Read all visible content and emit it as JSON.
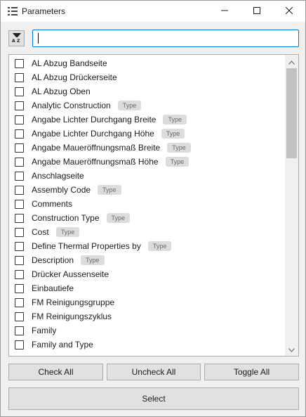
{
  "window": {
    "title": "Parameters"
  },
  "toolbar": {
    "sort_icon": "sort-alpha-filter-icon",
    "search_value": "",
    "search_placeholder": ""
  },
  "parameters": [
    {
      "name": "AL Abzug Bandseite",
      "badge": ""
    },
    {
      "name": "AL Abzug Drückerseite",
      "badge": ""
    },
    {
      "name": "AL Abzug Oben",
      "badge": ""
    },
    {
      "name": "Analytic Construction",
      "badge": "Type"
    },
    {
      "name": "Angabe Lichter Durchgang Breite",
      "badge": "Type"
    },
    {
      "name": "Angabe Lichter Durchgang Höhe",
      "badge": "Type"
    },
    {
      "name": "Angabe Maueröffnungsmaß Breite",
      "badge": "Type"
    },
    {
      "name": "Angabe Maueröffnungsmaß Höhe",
      "badge": "Type"
    },
    {
      "name": "Anschlagseite",
      "badge": ""
    },
    {
      "name": "Assembly Code",
      "badge": "Type"
    },
    {
      "name": "Comments",
      "badge": ""
    },
    {
      "name": "Construction Type",
      "badge": "Type"
    },
    {
      "name": "Cost",
      "badge": "Type"
    },
    {
      "name": "Define Thermal Properties by",
      "badge": "Type"
    },
    {
      "name": "Description",
      "badge": "Type"
    },
    {
      "name": "Drücker Aussenseite",
      "badge": ""
    },
    {
      "name": "Einbautiefe",
      "badge": ""
    },
    {
      "name": "FM Reinigungsgruppe",
      "badge": ""
    },
    {
      "name": "FM Reinigungszyklus",
      "badge": ""
    },
    {
      "name": "Family",
      "badge": ""
    },
    {
      "name": "Family and Type",
      "badge": ""
    }
  ],
  "buttons": {
    "check_all": "Check All",
    "uncheck_all": "Uncheck All",
    "toggle_all": "Toggle All",
    "select": "Select"
  },
  "colors": {
    "accent": "#0078d7",
    "badge_bg": "#dcdcdc",
    "button_bg": "#e1e1e1"
  }
}
